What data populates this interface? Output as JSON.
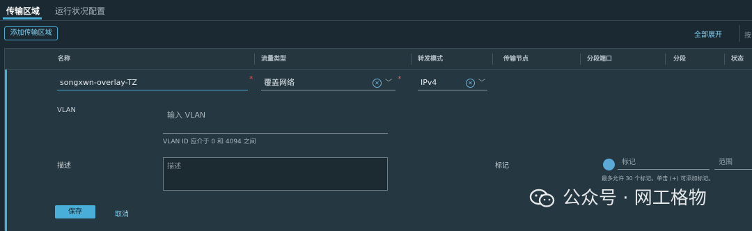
{
  "tabs": [
    {
      "label": "传输区域"
    },
    {
      "label": "运行状况配置"
    }
  ],
  "toolbar": {
    "add_label": "添加传输区域",
    "expand_label": "全部展开",
    "search_placeholder": "按"
  },
  "columns": [
    "名称",
    "流量类型",
    "转发模式",
    "传输节点",
    "分段端口",
    "分段",
    "状态"
  ],
  "form": {
    "name_value": "songxwn-overlay-TZ",
    "traffic_type": "覆盖网络",
    "forwarding_mode": "IPv4",
    "vlan_label": "VLAN",
    "vlan_placeholder": "输入 VLAN",
    "vlan_hint": "VLAN ID 应介于 0 和 4094 之间",
    "desc_label": "描述",
    "desc_placeholder": "描述",
    "tags_label": "标记",
    "tag_placeholder": "标记",
    "scope_placeholder": "范围",
    "tags_hint": "最多允许 30 个标记。单击 (+) 可添加标记。",
    "save_label": "保存",
    "cancel_label": "取消"
  },
  "watermark": {
    "text": "公众号 · 网工格物"
  }
}
